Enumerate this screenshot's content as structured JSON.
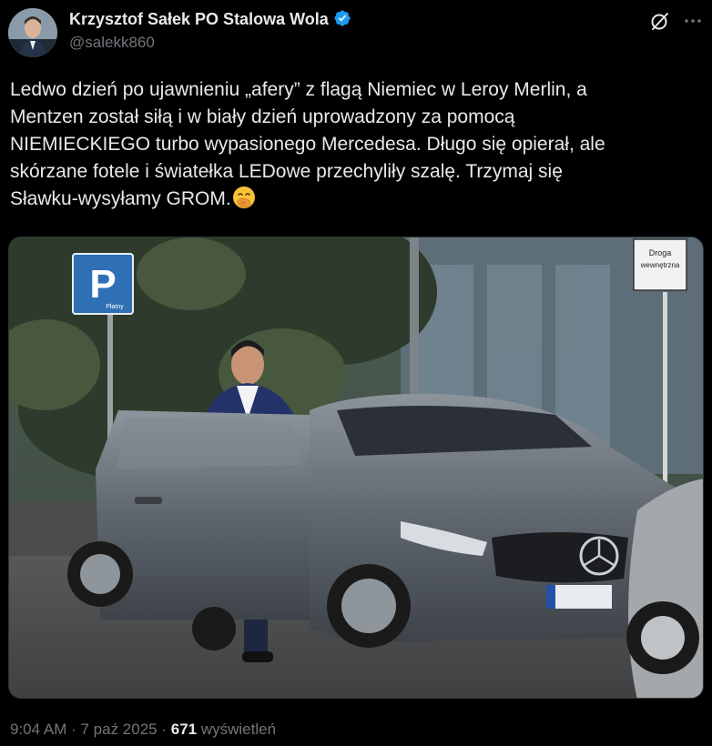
{
  "author": {
    "name": "Krzysztof Sałek PO Stalowa Wola",
    "handle": "@salekk860",
    "verified_icon": "verified-badge-icon"
  },
  "actions": {
    "grok_icon": "grok-icon",
    "more_icon": "more-dots-icon"
  },
  "tweet": {
    "lines": [
      "Ledwo dzień po ujawnieniu „afery” z flagą Niemiec w Leroy Merlin, a",
      "Mentzen został siłą i w biały dzień uprowadzony za pomocą",
      "NIEMIECKIEGO turbo wypasionego Mercedesa. Długo się opierał, ale",
      "skórzane fotele i światełka LEDowe przechyliły szalę. Trzymaj się",
      "Sławku-wysyłamy GROM."
    ],
    "emoji": "face-with-hand-over-mouth-emoji"
  },
  "media": {
    "parking_sign": "P",
    "parking_sub": "Płatny",
    "road_sign_line1": "Droga",
    "road_sign_line2": "wewnętrzna"
  },
  "footer": {
    "time": "9:04 AM",
    "sep1": " · ",
    "date": "7 paź 2025",
    "sep2": " · ",
    "views": "671",
    "views_label": " wyświetleń"
  },
  "colors": {
    "background": "#000000",
    "text": "#e7e9ea",
    "secondary": "#71767b",
    "verified": "#1d9bf0"
  }
}
